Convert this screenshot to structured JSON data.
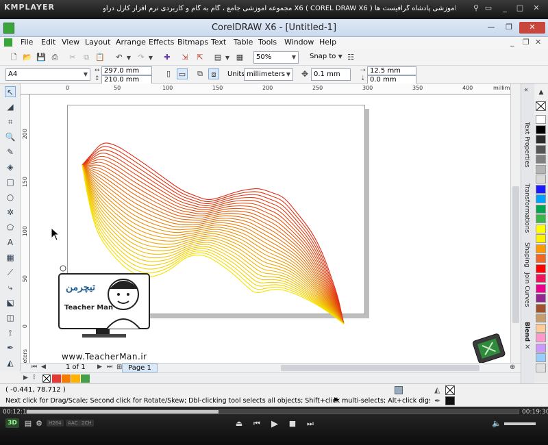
{
  "player": {
    "logo": "KMPLAYER",
    "title": "مجموعه آموزشی جامع ، گام به گام و کاربردی نرم افزار کارل دراو X6 ( COREL DRAW X6 ) مدرس : سعید فدایی (تیچرمن) گروه آموزشی پادشاه گرافیست ها",
    "time_elapsed": "00:12:10",
    "time_total": "00:19:30",
    "progress": 0.39,
    "badges": [
      "3D",
      "H264",
      "AAC",
      "2CH"
    ]
  },
  "window": {
    "title": "CorelDRAW X6 - [Untitled-1]"
  },
  "menu": [
    "File",
    "Edit",
    "View",
    "Layout",
    "Arrange",
    "Effects",
    "Bitmaps",
    "Text",
    "Table",
    "Tools",
    "Window",
    "Help"
  ],
  "toolbar": {
    "zoom": "50%",
    "snap_to": "Snap to"
  },
  "property_bar": {
    "page_size": "A4",
    "width": "297.0 mm",
    "height": "210.0 mm",
    "units_label": "Units:",
    "units": "millimeters",
    "nudge": "0.1 mm",
    "dup_x": "12.5 mm",
    "dup_y": "0.0 mm"
  },
  "ruler": {
    "h_ticks": [
      "0",
      "50",
      "100",
      "150",
      "200",
      "250",
      "300",
      "350",
      "400"
    ],
    "h_unit": "millimeters",
    "v_ticks": [
      "200",
      "150",
      "100",
      "50",
      "0"
    ],
    "v_unit": "millimeters"
  },
  "dockers": [
    "Text Properties",
    "Transformations",
    "Shaping",
    "Join Curves",
    "Blend"
  ],
  "palette_colors": [
    "#ffffff",
    "#000000",
    "#2b2b2b",
    "#555555",
    "#808080",
    "#b4b4b4",
    "#d8d8d8",
    "#1a1aff",
    "#00a0ff",
    "#00a651",
    "#39b54a",
    "#ffff00",
    "#fff200",
    "#ff9900",
    "#f26522",
    "#ff0000",
    "#ed145b",
    "#ec008c",
    "#92278f",
    "#a0522d",
    "#c69c6d",
    "#ffcc99",
    "#ff99cc",
    "#cc99ff",
    "#99ccff",
    "#e0e0e0"
  ],
  "page_nav": {
    "counter": "1 of 1",
    "page_tab": "Page 1"
  },
  "doc_palette": [
    "#e53935",
    "#f57c00",
    "#ffb300",
    "#43a047"
  ],
  "status": {
    "coords": "( -0.441, 78.712 )",
    "hint": "Next click for Drag/Scale; Second click for Rotate/Skew; Dbl-clicking tool selects all objects; Shift+click multi-selects; Alt+click digs"
  },
  "watermark": {
    "url": "www.TeacherMan.ir",
    "logo_fa": "تیچرمن",
    "logo_en": "Teacher Man"
  },
  "colors": {
    "wave_start": "#f5e200",
    "wave_end": "#e02a12"
  }
}
